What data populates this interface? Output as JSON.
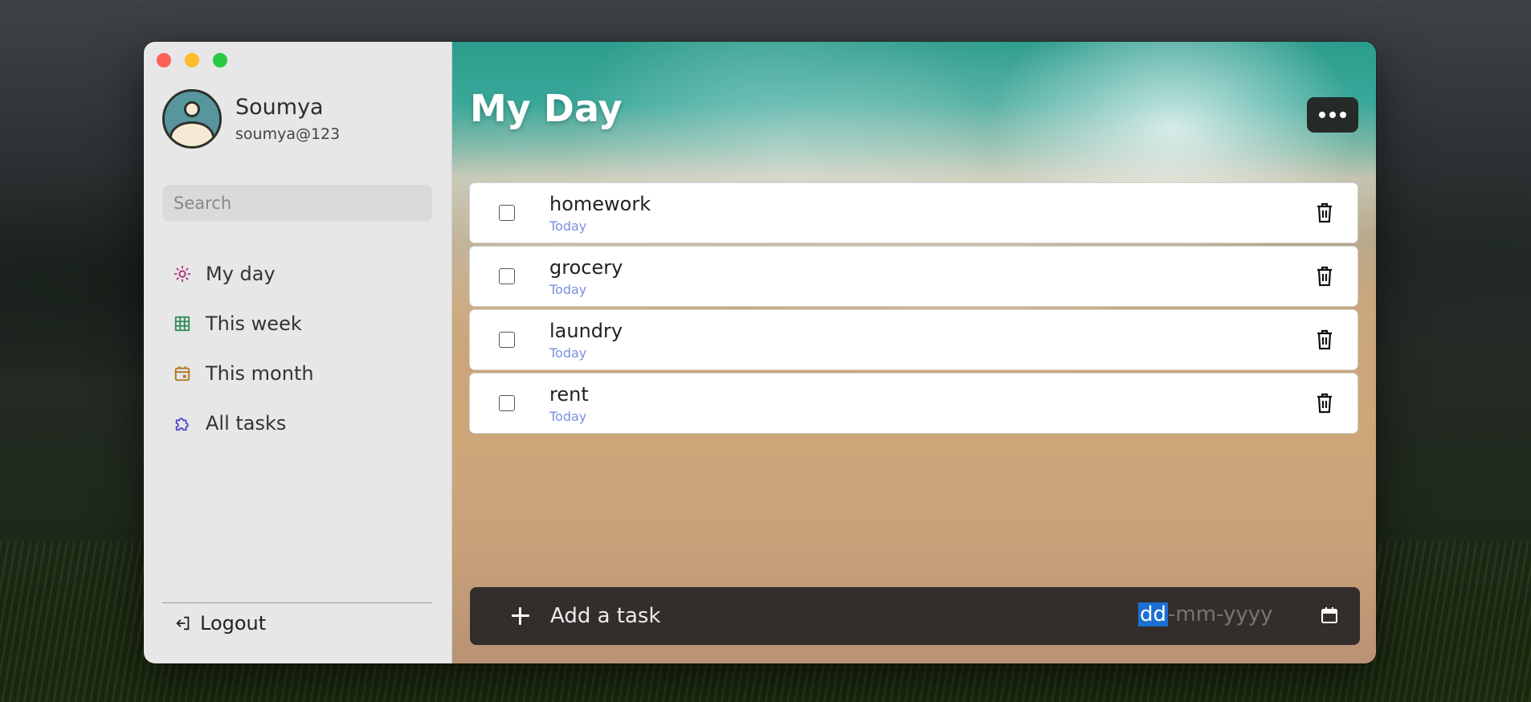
{
  "window": {
    "traffic_lights": [
      "close",
      "minimize",
      "zoom"
    ]
  },
  "sidebar": {
    "profile": {
      "name": "Soumya",
      "handle": "soumya@123"
    },
    "search": {
      "placeholder": "Search",
      "value": ""
    },
    "items": [
      {
        "label": "My day",
        "icon": "sun-icon",
        "color": "#b0277c"
      },
      {
        "label": "This week",
        "icon": "grid-table-icon",
        "color": "#2e8b57"
      },
      {
        "label": "This month",
        "icon": "calendar-icon",
        "color": "#b0741c"
      },
      {
        "label": "All tasks",
        "icon": "puzzle-icon",
        "color": "#4a4ad0"
      }
    ],
    "logout": {
      "label": "Logout",
      "icon": "logout-icon"
    }
  },
  "main": {
    "title": "My Day",
    "more_icon": "ellipsis-icon",
    "tasks": [
      {
        "title": "homework",
        "due": "Today",
        "done": false
      },
      {
        "title": "grocery",
        "due": "Today",
        "done": false
      },
      {
        "title": "laundry",
        "due": "Today",
        "done": false
      },
      {
        "title": "rent",
        "due": "Today",
        "done": false
      }
    ],
    "add_task": {
      "placeholder": "Add a task",
      "date_placeholder_dd": "dd",
      "date_placeholder_rest": "-mm-yyyy",
      "date_icon": "calendar-icon"
    }
  },
  "colors": {
    "accent_date_text": "#7a8fe0",
    "add_bar": "#332e2c",
    "date_highlight": "#1b6fd2"
  }
}
